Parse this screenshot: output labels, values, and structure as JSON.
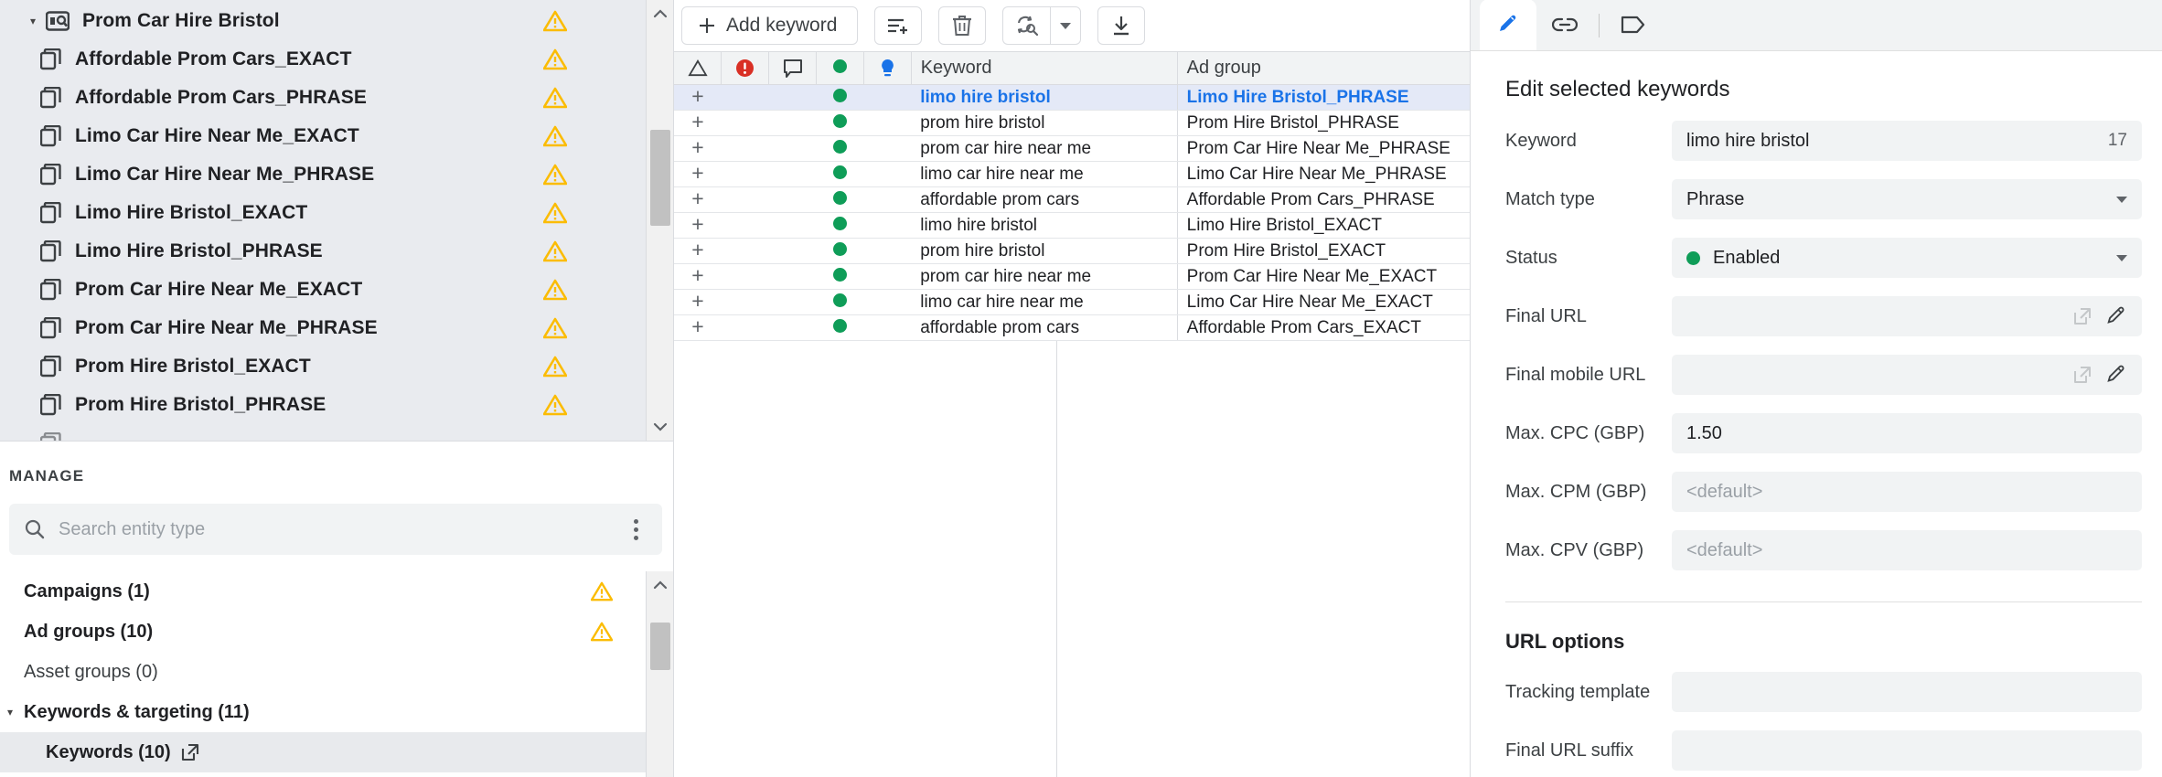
{
  "tree": {
    "root": {
      "label": "Prom Car Hire Bristol",
      "icon": "search-campaign-icon",
      "expanded": true,
      "has_warning": true
    },
    "children": [
      {
        "label": "Affordable Prom Cars_EXACT",
        "has_warning": true
      },
      {
        "label": "Affordable Prom Cars_PHRASE",
        "has_warning": true
      },
      {
        "label": "Limo Car Hire Near Me_EXACT",
        "has_warning": true
      },
      {
        "label": "Limo Car Hire Near Me_PHRASE",
        "has_warning": true
      },
      {
        "label": "Limo Hire Bristol_EXACT",
        "has_warning": true
      },
      {
        "label": "Limo Hire Bristol_PHRASE",
        "has_warning": true
      },
      {
        "label": "Prom Car Hire Near Me_EXACT",
        "has_warning": true
      },
      {
        "label": "Prom Car Hire Near Me_PHRASE",
        "has_warning": true
      },
      {
        "label": "Prom Hire Bristol_EXACT",
        "has_warning": true
      },
      {
        "label": "Prom Hire Bristol_PHRASE",
        "has_warning": true
      }
    ]
  },
  "manage": {
    "title": "MANAGE",
    "search_placeholder": "Search entity type",
    "search_value": "",
    "entities": [
      {
        "label": "Campaigns (1)",
        "bold": true,
        "warning": true,
        "indent": false,
        "selected": false,
        "twisty": ""
      },
      {
        "label": "Ad groups (10)",
        "bold": true,
        "warning": true,
        "indent": false,
        "selected": false,
        "twisty": ""
      },
      {
        "label": "Asset groups (0)",
        "bold": false,
        "warning": false,
        "indent": false,
        "selected": false,
        "twisty": ""
      },
      {
        "label": "Keywords & targeting (11)",
        "bold": true,
        "warning": false,
        "indent": false,
        "selected": false,
        "twisty": "▾"
      },
      {
        "label": "Keywords (10)",
        "bold": true,
        "warning": false,
        "indent": true,
        "selected": true,
        "twisty": "",
        "external_link": true
      }
    ]
  },
  "toolbar": {
    "add_keyword_label": "Add keyword",
    "add_keyword_icon": "plus-icon",
    "buttons": [
      {
        "name": "add-rows-icon",
        "title": "Add rows"
      },
      {
        "name": "delete-icon",
        "title": "Delete"
      },
      {
        "name": "replace-icon",
        "title": "Find and replace"
      },
      {
        "name": "download-icon",
        "title": "Download"
      }
    ],
    "dropdown_icon": "chevron-down-icon"
  },
  "table": {
    "columns": [
      {
        "key": "expand",
        "label": "",
        "icon": "warning-triangle-icon"
      },
      {
        "key": "error",
        "label": "",
        "icon": "error-circle-icon"
      },
      {
        "key": "comment",
        "label": "",
        "icon": "comment-icon"
      },
      {
        "key": "status",
        "label": "",
        "icon": "green-dot-icon"
      },
      {
        "key": "idea",
        "label": "",
        "icon": "lightbulb-icon"
      },
      {
        "key": "keyword",
        "label": "Keyword"
      },
      {
        "key": "adgroup",
        "label": "Ad group"
      }
    ],
    "rows": [
      {
        "keyword": "limo hire bristol",
        "adgroup": "Limo Hire Bristol_PHRASE",
        "status": "enabled",
        "selected": true
      },
      {
        "keyword": "prom hire bristol",
        "adgroup": "Prom Hire Bristol_PHRASE",
        "status": "enabled",
        "selected": false
      },
      {
        "keyword": "prom car hire near me",
        "adgroup": "Prom Car Hire Near Me_PHRASE",
        "status": "enabled",
        "selected": false
      },
      {
        "keyword": "limo car hire near me",
        "adgroup": "Limo Car Hire Near Me_PHRASE",
        "status": "enabled",
        "selected": false
      },
      {
        "keyword": "affordable prom cars",
        "adgroup": "Affordable Prom Cars_PHRASE",
        "status": "enabled",
        "selected": false
      },
      {
        "keyword": "limo hire bristol",
        "adgroup": "Limo Hire Bristol_EXACT",
        "status": "enabled",
        "selected": false
      },
      {
        "keyword": "prom hire bristol",
        "adgroup": "Prom Hire Bristol_EXACT",
        "status": "enabled",
        "selected": false
      },
      {
        "keyword": "prom car hire near me",
        "adgroup": "Prom Car Hire Near Me_EXACT",
        "status": "enabled",
        "selected": false
      },
      {
        "keyword": "limo car hire near me",
        "adgroup": "Limo Car Hire Near Me_EXACT",
        "status": "enabled",
        "selected": false
      },
      {
        "keyword": "affordable prom cars",
        "adgroup": "Affordable Prom Cars_EXACT",
        "status": "enabled",
        "selected": false
      }
    ]
  },
  "editor": {
    "tabs": [
      {
        "name": "edit-tab",
        "icon": "pencil-icon",
        "active": true
      },
      {
        "name": "links-tab",
        "icon": "link-icon",
        "active": false
      },
      {
        "name": "labels-tab",
        "icon": "tag-icon",
        "active": false
      }
    ],
    "title": "Edit selected keywords",
    "fields": {
      "keyword_label": "Keyword",
      "keyword_value": "limo hire bristol",
      "keyword_count": "17",
      "match_type_label": "Match type",
      "match_type_value": "Phrase",
      "status_label": "Status",
      "status_value": "Enabled",
      "final_url_label": "Final URL",
      "final_url_value": "",
      "final_mobile_url_label": "Final mobile URL",
      "final_mobile_url_value": "",
      "max_cpc_label": "Max. CPC (GBP)",
      "max_cpc_value": "1.50",
      "max_cpm_label": "Max. CPM (GBP)",
      "max_cpm_value": "<default>",
      "max_cpv_label": "Max. CPV (GBP)",
      "max_cpv_value": "<default>"
    },
    "url_options": {
      "section_title": "URL options",
      "tracking_template_label": "Tracking template",
      "tracking_template_value": "",
      "final_url_suffix_label": "Final URL suffix",
      "final_url_suffix_value": ""
    }
  },
  "colors": {
    "accent_blue": "#1a73e8",
    "status_green": "#0f9d58",
    "warning_amber": "#fbbc04",
    "error_red": "#d93025",
    "selection_blue": "#e4e9f7"
  }
}
